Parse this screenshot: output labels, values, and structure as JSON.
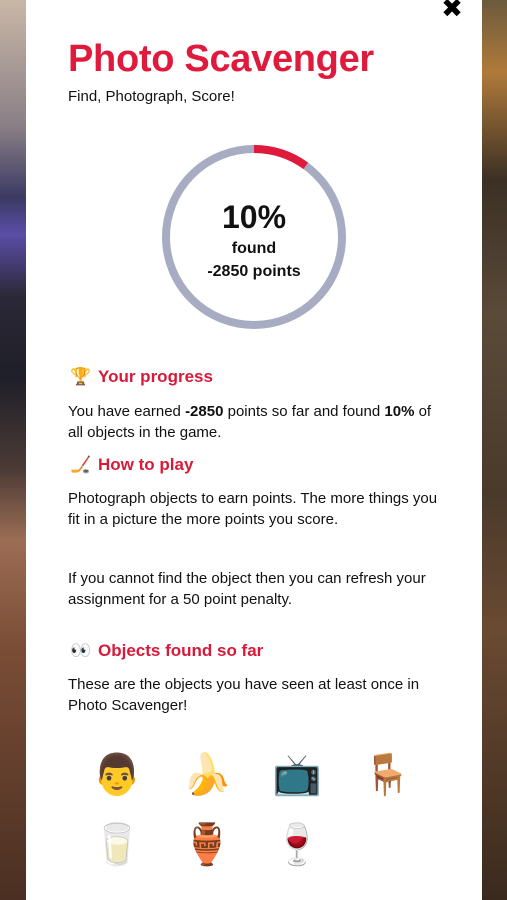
{
  "header": {
    "close_label": "✖",
    "title": "Photo Scavenger",
    "subtitle": "Find, Photograph, Score!"
  },
  "progress_ring": {
    "percent_label": "10%",
    "found_label": "found",
    "points_label": "-2850 points",
    "fraction": 0.1,
    "track_color": "#a8acc3",
    "fill_color": "#e01a3c"
  },
  "sections": {
    "progress": {
      "icon": "🏆",
      "heading": "Your progress",
      "text_1": "You have earned ",
      "points": "-2850",
      "text_2": " points so far and found ",
      "percent": "10%",
      "text_3": " of all objects in the game."
    },
    "how_to_play": {
      "icon": "🏒",
      "heading": "How to play",
      "para_1": "Photograph objects to earn points. The more things you fit in a picture the more points you score.",
      "para_2": "If you cannot find the object then you can refresh your assignment for a 50 point penalty."
    },
    "objects": {
      "icon": "👀",
      "heading": "Objects found so far",
      "text": "These are the objects you have seen at least once in Photo Scavenger!"
    }
  },
  "found_objects": [
    {
      "emoji": "👨",
      "name": "man"
    },
    {
      "emoji": "🍌",
      "name": "banana"
    },
    {
      "emoji": "📺",
      "name": "television"
    },
    {
      "emoji": "🪑",
      "name": "chair"
    },
    {
      "emoji": "🥛",
      "name": "glass-of-milk"
    },
    {
      "emoji": "🏺",
      "name": "vase"
    },
    {
      "emoji": "🍷",
      "name": "wine-glass"
    }
  ]
}
